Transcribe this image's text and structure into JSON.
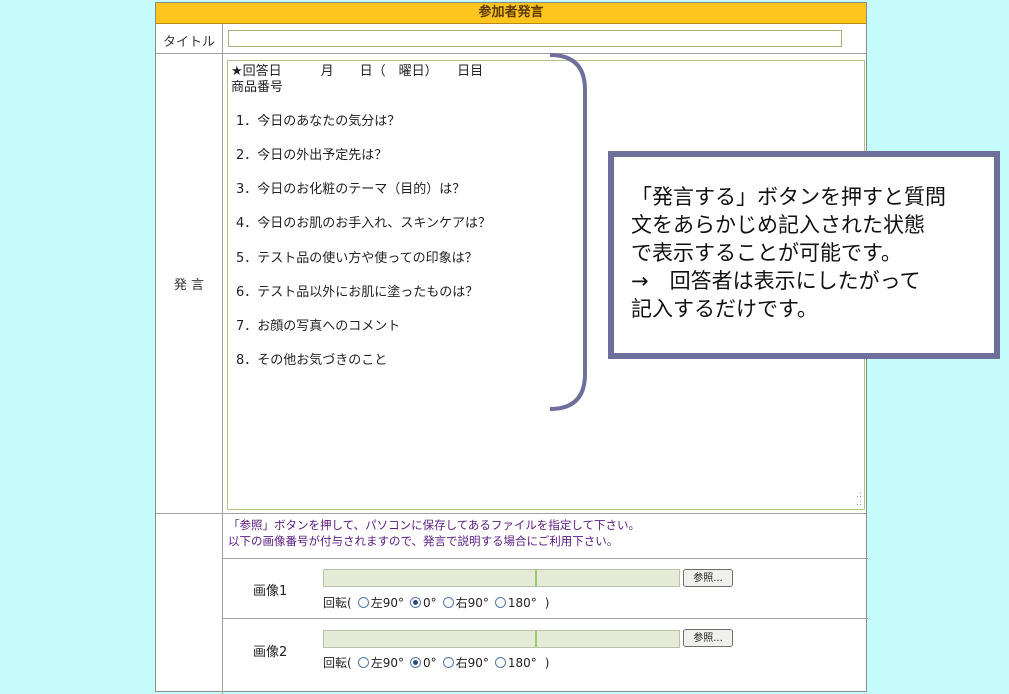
{
  "form": {
    "header": "参加者発言",
    "title_label": "タイトル",
    "title_value": "",
    "speech_label": "発 言",
    "textarea_lines": [
      "★回答日　　　月　　日（　曜日）　　日目",
      "商品番号"
    ],
    "questions": [
      "1．今日のあなたの気分は？",
      "2．今日の外出予定先は？",
      "3．今日のお化粧のテーマ（目的）は？",
      "4．今日のお肌のお手入れ、スキンケアは？",
      "5．テスト品の使い方や使っての印象は？",
      "6．テスト品以外にお肌に塗ったものは？",
      "7．お顔の写真へのコメント",
      "8．その他お気づきのこと"
    ],
    "image_instructions": [
      "「参照」ボタンを押して、パソコンに保存してあるファイルを指定して下さい。",
      "以下の画像番号が付与されますので、発言で説明する場合にご利用下さい。"
    ],
    "images": [
      {
        "label": "画像1",
        "browse_label": "参照...",
        "rotate_label": "回転(",
        "options": [
          "左90°",
          "0°",
          "右90°",
          "180°"
        ],
        "selected": "0°",
        "close_paren": ")"
      },
      {
        "label": "画像2",
        "browse_label": "参照...",
        "rotate_label": "回転(",
        "options": [
          "左90°",
          "0°",
          "右90°",
          "180°"
        ],
        "selected": "0°",
        "close_paren": ")"
      }
    ]
  },
  "callout": {
    "lines": [
      "「発言する」ボタンを押すと質問",
      "文をあらかじめ記入された状態",
      "で表示することが可能です。",
      "→　回答者は表示にしたがって",
      "記入するだけです。"
    ],
    "border_color": "#6f6f9c"
  },
  "colors": {
    "header_bg": "#ffc51f",
    "page_bg": "#c6fcfc",
    "instruction_text": "#5a1a80"
  }
}
